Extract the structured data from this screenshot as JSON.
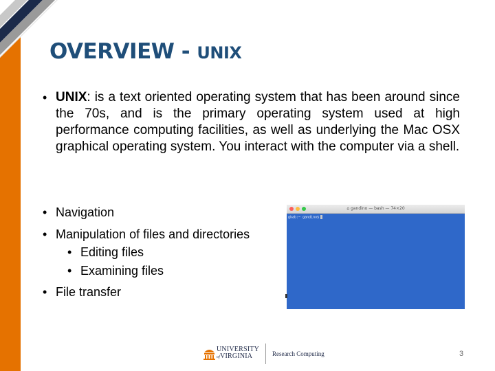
{
  "slide": {
    "title_main": "OVERVIEW",
    "title_sep": " - ",
    "title_sub": "UNIX",
    "paragraph": {
      "bold_term": "UNIX",
      "text": ": is a text oriented operating system that has been around since the 70s, and is the primary operating system used at high performance computing facilities, as well as underlying the Mac OSX graphical operating system. You interact with the computer via a shell."
    },
    "bullets": [
      {
        "label": "Navigation",
        "level": 1
      },
      {
        "label": "Manipulation of files and directories",
        "level": 1
      },
      {
        "label": "Editing files",
        "level": 2
      },
      {
        "label": "Examining files",
        "level": 2
      },
      {
        "label": "File transfer",
        "level": 1
      }
    ],
    "bullet_glyph": "•",
    "page_number": "3"
  },
  "terminal": {
    "title": "gandino — bash — 74×20",
    "prompt": "gkab:~ gandino$",
    "background": "#2f68c9"
  },
  "footer": {
    "uva_line1": "UNIVERSITY",
    "uva_line2": "VIRGINIA",
    "uva_of": "of",
    "department": "Research Computing"
  },
  "colors": {
    "accent_orange": "#e57200",
    "title_blue": "#1f4e79",
    "uva_navy": "#232d4b"
  }
}
